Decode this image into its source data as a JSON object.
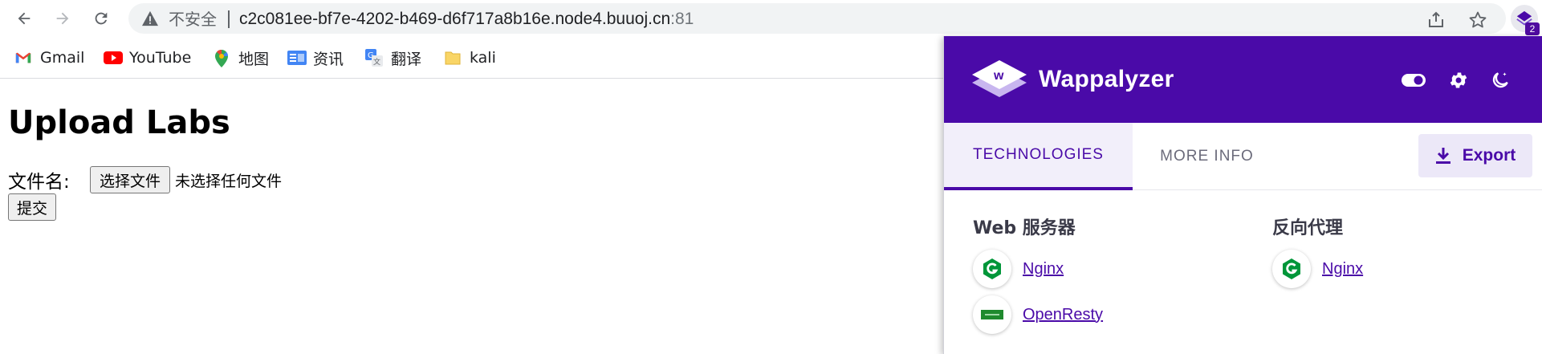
{
  "browser": {
    "security_label": "不安全",
    "url_main": "c2c081ee-bf7e-4202-b469-d6f717a8b16e.node4.buuoj.cn",
    "url_port": ":81",
    "extension_badge": "2"
  },
  "bookmarks": [
    {
      "label": "Gmail",
      "icon": "gmail-icon"
    },
    {
      "label": "YouTube",
      "icon": "youtube-icon"
    },
    {
      "label": "地图",
      "icon": "maps-icon"
    },
    {
      "label": "资讯",
      "icon": "news-icon"
    },
    {
      "label": "翻译",
      "icon": "translate-icon"
    },
    {
      "label": "kali",
      "icon": "folder-icon"
    }
  ],
  "page": {
    "title": "Upload Labs",
    "file_label": "文件名:",
    "choose_file_button": "选择文件",
    "no_file_text": "未选择任何文件",
    "submit_button": "提交"
  },
  "wappalyzer": {
    "brand": "Wappalyzer",
    "tabs": [
      "TECHNOLOGIES",
      "MORE INFO"
    ],
    "export_label": "Export",
    "categories": [
      {
        "name": "Web 服务器",
        "technologies": [
          "Nginx",
          "OpenResty"
        ]
      },
      {
        "name": "反向代理",
        "technologies": [
          "Nginx"
        ]
      }
    ],
    "colors": {
      "primary": "#4a0aa8",
      "nginx": "#009639",
      "openresty": "#1f8a2e"
    }
  }
}
